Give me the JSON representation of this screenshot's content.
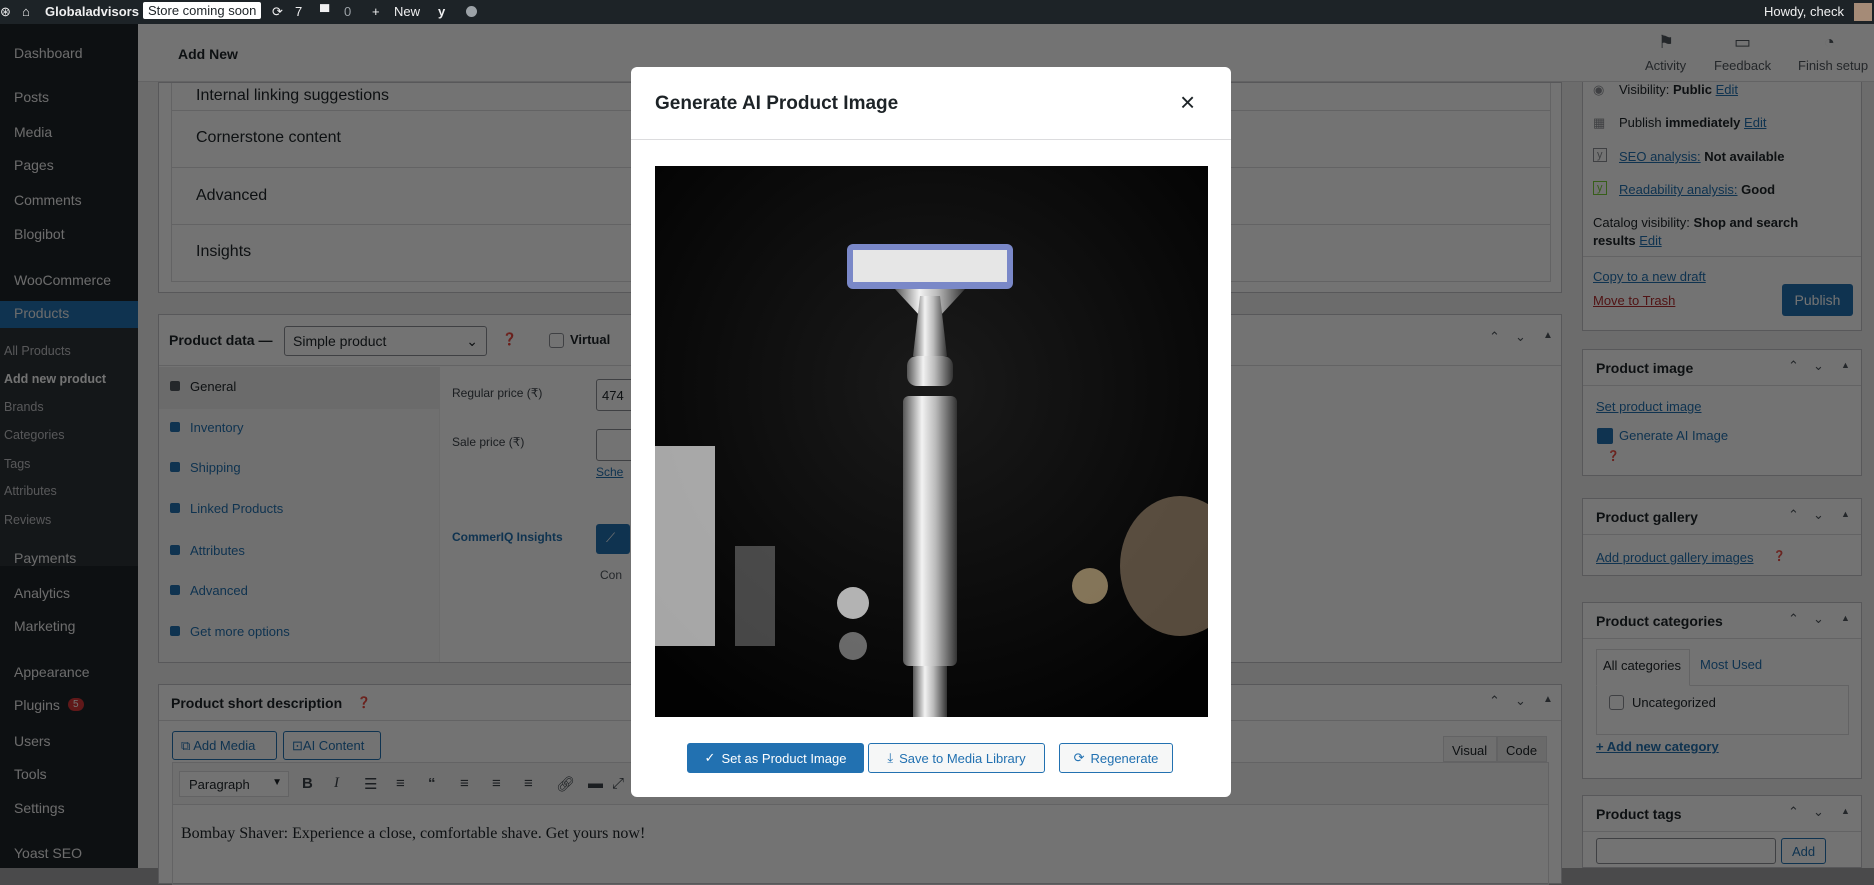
{
  "admin_bar": {
    "site_name": "Globaladvisors",
    "store_badge": "Store coming soon",
    "updates_count": "7",
    "comments_count": "0",
    "new_label": "New",
    "greeting": "Howdy, check"
  },
  "sidebar": {
    "items": [
      {
        "label": "Dashboard"
      },
      {
        "label": "Posts"
      },
      {
        "label": "Media"
      },
      {
        "label": "Pages"
      },
      {
        "label": "Comments"
      },
      {
        "label": "Blogibot"
      },
      {
        "label": "WooCommerce"
      },
      {
        "label": "Products"
      },
      {
        "label": "Payments"
      },
      {
        "label": "Analytics"
      },
      {
        "label": "Marketing"
      },
      {
        "label": "Appearance"
      },
      {
        "label": "Plugins"
      },
      {
        "label": "Users"
      },
      {
        "label": "Tools"
      },
      {
        "label": "Settings"
      },
      {
        "label": "Yoast SEO"
      }
    ],
    "submenu": [
      "All Products",
      "Add new product",
      "Brands",
      "Categories",
      "Tags",
      "Attributes",
      "Reviews"
    ],
    "plugins_badge": "5"
  },
  "header": {
    "title": "Add New",
    "activity": "Activity",
    "feedback": "Feedback",
    "finish_setup": "Finish setup"
  },
  "yoast_rows": [
    "Internal linking suggestions",
    "Cornerstone content",
    "Advanced",
    "Insights"
  ],
  "product_data": {
    "title": "Product data —",
    "type": "Simple product",
    "virtual": "Virtual",
    "tabs": [
      "General",
      "Inventory",
      "Shipping",
      "Linked Products",
      "Attributes",
      "Advanced",
      "Get more options"
    ],
    "regular_price_label": "Regular price (₹)",
    "regular_price_value": "474",
    "sale_price_label": "Sale price (₹)",
    "schedule_link": "Sche",
    "commeriq_label": "CommerIQ Insights",
    "commeriq_text": "Con"
  },
  "short_desc": {
    "title": "Product short description",
    "add_media": "Add Media",
    "ai_content": "AI Content",
    "visual": "Visual",
    "code": "Code",
    "format": "Paragraph",
    "content": "Bombay Shaver: Experience a close, comfortable shave. Get yours now!"
  },
  "publish": {
    "visibility_label": "Visibility:",
    "visibility_value": "Public",
    "edit": "Edit",
    "publish_label": "Publish",
    "publish_value": "immediately",
    "seo_label": "SEO analysis:",
    "seo_value": "Not available",
    "read_label": "Readability analysis:",
    "read_value": "Good",
    "catalog_label": "Catalog visibility:",
    "catalog_value": "Shop and search results",
    "copy": "Copy to a new draft",
    "trash": "Move to Trash",
    "publish_btn": "Publish"
  },
  "product_image": {
    "title": "Product image",
    "set": "Set product image",
    "generate": "Generate AI Image"
  },
  "gallery": {
    "title": "Product gallery",
    "add": "Add product gallery images"
  },
  "categories": {
    "title": "Product categories",
    "tab_all": "All categories",
    "tab_most": "Most Used",
    "item": "Uncategorized",
    "add": "+ Add new category"
  },
  "tags": {
    "title": "Product tags",
    "add": "Add"
  },
  "modal": {
    "title": "Generate AI Product Image",
    "set_btn": "Set as Product Image",
    "save_btn": "Save to Media Library",
    "regen_btn": "Regenerate"
  }
}
